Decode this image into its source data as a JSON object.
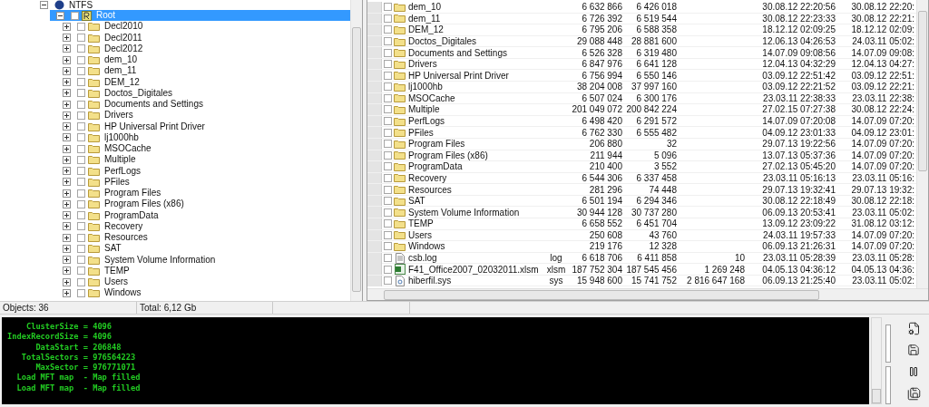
{
  "tree": {
    "volume": {
      "label": "NTFS",
      "expanded": true
    },
    "root": {
      "label": "Root",
      "selected": true,
      "checked": false,
      "expanded": true
    },
    "items": [
      {
        "label": "Decl2010",
        "checked": false
      },
      {
        "label": "Decl2011",
        "checked": false
      },
      {
        "label": "Decl2012",
        "checked": false
      },
      {
        "label": "dem_10",
        "checked": false
      },
      {
        "label": "dem_11",
        "checked": false
      },
      {
        "label": "DEM_12",
        "checked": false
      },
      {
        "label": "Doctos_Digitales",
        "checked": false
      },
      {
        "label": "Documents and Settings",
        "checked": false
      },
      {
        "label": "Drivers",
        "checked": false
      },
      {
        "label": "HP Universal Print Driver",
        "checked": false
      },
      {
        "label": "lj1000hb",
        "checked": false
      },
      {
        "label": "MSOCache",
        "checked": false
      },
      {
        "label": "Multiple",
        "checked": false
      },
      {
        "label": "PerfLogs",
        "checked": false
      },
      {
        "label": "PFiles",
        "checked": false
      },
      {
        "label": "Program Files",
        "checked": false
      },
      {
        "label": "Program Files (x86)",
        "checked": false
      },
      {
        "label": "ProgramData",
        "checked": false
      },
      {
        "label": "Recovery",
        "checked": false
      },
      {
        "label": "Resources",
        "checked": false
      },
      {
        "label": "SAT",
        "checked": false
      },
      {
        "label": "System Volume Information",
        "checked": false
      },
      {
        "label": "TEMP",
        "checked": false
      },
      {
        "label": "Users",
        "checked": false
      },
      {
        "label": "Windows",
        "checked": false
      }
    ]
  },
  "table": {
    "rows": [
      {
        "kind": "folder",
        "checked": false,
        "name": "dem_10",
        "ext": "",
        "size": "6 632 866",
        "size_2": "6 426 018",
        "column_5": "",
        "date_1": "30.08.12 22:20:56",
        "date_2": "30.08.12 22:20:"
      },
      {
        "kind": "folder",
        "checked": false,
        "name": "dem_11",
        "ext": "",
        "size": "6 726 392",
        "size_2": "6 519 544",
        "column_5": "",
        "date_1": "30.08.12 22:23:33",
        "date_2": "30.08.12 22:21:"
      },
      {
        "kind": "folder",
        "checked": false,
        "name": "DEM_12",
        "ext": "",
        "size": "6 795 206",
        "size_2": "6 588 358",
        "column_5": "",
        "date_1": "18.12.12 02:09:25",
        "date_2": "18.12.12 02:09:"
      },
      {
        "kind": "folder",
        "checked": false,
        "name": "Doctos_Digitales",
        "ext": "",
        "size": "29 088 448",
        "size_2": "28 881 600",
        "column_5": "",
        "date_1": "12.06.13 04:26:53",
        "date_2": "24.03.11 05:02:"
      },
      {
        "kind": "folder",
        "checked": false,
        "name": "Documents and Settings",
        "ext": "",
        "size": "6 526 328",
        "size_2": "6 319 480",
        "column_5": "",
        "date_1": "14.07.09 09:08:56",
        "date_2": "14.07.09 09:08:"
      },
      {
        "kind": "folder",
        "checked": false,
        "name": "Drivers",
        "ext": "",
        "size": "6 847 976",
        "size_2": "6 641 128",
        "column_5": "",
        "date_1": "12.04.13 04:32:29",
        "date_2": "12.04.13 04:27:"
      },
      {
        "kind": "folder",
        "checked": false,
        "name": "HP Universal Print Driver",
        "ext": "",
        "size": "6 756 994",
        "size_2": "6 550 146",
        "column_5": "",
        "date_1": "03.09.12 22:51:42",
        "date_2": "03.09.12 22:51:"
      },
      {
        "kind": "folder",
        "checked": false,
        "name": "lj1000hb",
        "ext": "",
        "size": "38 204 008",
        "size_2": "37 997 160",
        "column_5": "",
        "date_1": "03.09.12 22:21:52",
        "date_2": "03.09.12 22:21:"
      },
      {
        "kind": "folder",
        "checked": false,
        "name": "MSOCache",
        "ext": "",
        "size": "6 507 024",
        "size_2": "6 300 176",
        "column_5": "",
        "date_1": "23.03.11 22:38:33",
        "date_2": "23.03.11 22:38:"
      },
      {
        "kind": "folder",
        "checked": false,
        "name": "Multiple",
        "ext": "",
        "size": "201 049 072",
        "size_2": "200 842 224",
        "column_5": "",
        "date_1": "27.02.15 07:27:38",
        "date_2": "30.08.12 22:24:"
      },
      {
        "kind": "folder",
        "checked": false,
        "name": "PerfLogs",
        "ext": "",
        "size": "6 498 420",
        "size_2": "6 291 572",
        "column_5": "",
        "date_1": "14.07.09 07:20:08",
        "date_2": "14.07.09 07:20:"
      },
      {
        "kind": "folder",
        "checked": false,
        "name": "PFiles",
        "ext": "",
        "size": "6 762 330",
        "size_2": "6 555 482",
        "column_5": "",
        "date_1": "04.09.12 23:01:33",
        "date_2": "04.09.12 23:01:"
      },
      {
        "kind": "folder",
        "checked": false,
        "name": "Program Files",
        "ext": "",
        "size": "206 880",
        "size_2": "32",
        "column_5": "",
        "date_1": "29.07.13 19:22:56",
        "date_2": "14.07.09 07:20:"
      },
      {
        "kind": "folder",
        "checked": false,
        "name": "Program Files (x86)",
        "ext": "",
        "size": "211 944",
        "size_2": "5 096",
        "column_5": "",
        "date_1": "13.07.13 05:37:36",
        "date_2": "14.07.09 07:20:"
      },
      {
        "kind": "folder",
        "checked": false,
        "name": "ProgramData",
        "ext": "",
        "size": "210 400",
        "size_2": "3 552",
        "column_5": "",
        "date_1": "27.02.13 05:45:20",
        "date_2": "14.07.09 07:20:"
      },
      {
        "kind": "folder",
        "checked": false,
        "name": "Recovery",
        "ext": "",
        "size": "6 544 306",
        "size_2": "6 337 458",
        "column_5": "",
        "date_1": "23.03.11 05:16:13",
        "date_2": "23.03.11 05:16:"
      },
      {
        "kind": "folder",
        "checked": false,
        "name": "Resources",
        "ext": "",
        "size": "281 296",
        "size_2": "74 448",
        "column_5": "",
        "date_1": "29.07.13 19:32:41",
        "date_2": "29.07.13 19:32:"
      },
      {
        "kind": "folder",
        "checked": false,
        "name": "SAT",
        "ext": "",
        "size": "6 501 194",
        "size_2": "6 294 346",
        "column_5": "",
        "date_1": "30.08.12 22:18:49",
        "date_2": "30.08.12 22:18:"
      },
      {
        "kind": "folder",
        "checked": false,
        "name": "System Volume Information",
        "ext": "",
        "size": "30 944 128",
        "size_2": "30 737 280",
        "column_5": "",
        "date_1": "06.09.13 20:53:41",
        "date_2": "23.03.11 05:02:"
      },
      {
        "kind": "folder",
        "checked": false,
        "name": "TEMP",
        "ext": "",
        "size": "6 658 552",
        "size_2": "6 451 704",
        "column_5": "",
        "date_1": "13.09.12 23:09:22",
        "date_2": "31.08.12 03:12:"
      },
      {
        "kind": "folder",
        "checked": false,
        "name": "Users",
        "ext": "",
        "size": "250 608",
        "size_2": "43 760",
        "column_5": "",
        "date_1": "24.03.11 19:57:33",
        "date_2": "14.07.09 07:20:"
      },
      {
        "kind": "folder",
        "checked": false,
        "name": "Windows",
        "ext": "",
        "size": "219 176",
        "size_2": "12 328",
        "column_5": "",
        "date_1": "06.09.13 21:26:31",
        "date_2": "14.07.09 07:20:"
      },
      {
        "kind": "text",
        "checked": false,
        "name": "csb.log",
        "ext": "log",
        "size": "6 618 706",
        "size_2": "6 411 858",
        "column_5": "10",
        "date_1": "23.03.11 05:28:39",
        "date_2": "23.03.11 05:28:"
      },
      {
        "kind": "spreadsheet",
        "checked": false,
        "name": "F41_Office2007_02032011.xlsm",
        "ext": "xlsm",
        "size": "187 752 304",
        "size_2": "187 545 456",
        "column_5": "1 269 248",
        "date_1": "04.05.13 04:36:12",
        "date_2": "04.05.13 04:36:"
      },
      {
        "kind": "system",
        "checked": false,
        "name": "hiberfil.sys",
        "ext": "sys",
        "size": "15 948 600",
        "size_2": "15 741 752",
        "column_5": "2 816 647 168",
        "date_1": "06.09.13 21:25:40",
        "date_2": "23.03.11 05:02:"
      }
    ]
  },
  "status_bar": {
    "objects": "Objects: 36",
    "total": "Total: 6,12 Gb"
  },
  "console": {
    "lines": [
      "    ClusterSize = 4096",
      "IndexRecordSize = 4096",
      "      DataStart = 206848",
      "   TotalSectors = 976564223",
      "      MaxSector = 976771071",
      "  Load MFT map  - Map filled",
      "  Load MFT map  - Map filled"
    ]
  }
}
